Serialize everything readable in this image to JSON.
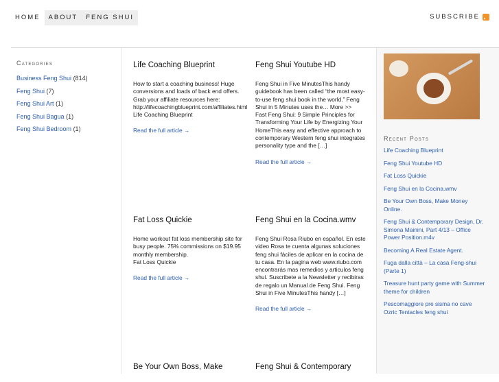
{
  "nav": {
    "items": [
      "HOME",
      "ABOUT",
      "FENG SHUI"
    ],
    "subscribe": "SUBSCRIBE"
  },
  "sidebar": {
    "title": "Categories",
    "categories": [
      {
        "name": "Business Feng Shui",
        "count": "(814)"
      },
      {
        "name": "Feng Shui",
        "count": "(7)"
      },
      {
        "name": "Feng Shui Art",
        "count": "(1)"
      },
      {
        "name": "Feng Shui Bagua",
        "count": "(1)"
      },
      {
        "name": "Feng Shui Bedroom",
        "count": "(1)"
      }
    ]
  },
  "posts": [
    {
      "title": "Life Coaching Blueprint",
      "excerpt": "How to start a coaching business! Huge conversions and loads of back end offers. Grab your affiliate resources here: http://lifecoachingblueprint.com/affiliates.html\nLife Coaching Blueprint",
      "more": "Read the full article →"
    },
    {
      "title": "Feng Shui Youtube HD",
      "excerpt": "Feng Shui in Five MinutesThis handy guidebook has been called “the most easy-to-use feng shui book in the world.” Feng Shui in 5 Minutes uses the… More >>\nFast Feng Shui: 9 Simple Principles for Transforming Your Life by Energizing Your HomeThis easy and effective approach to contemporary Western feng shui integrates personality type and the […]",
      "more": "Read the full article →"
    },
    {
      "title": "Fat Loss Quickie",
      "excerpt": "Home workout fat loss membership site for busy people. 75% commissions on $19.95 monthly membership.\nFat Loss Quickie",
      "more": "Read the full article →"
    },
    {
      "title": "Feng Shui en la Cocina.wmv",
      "excerpt": "Feng Shui Rosa Riubo en español. En este video Rosa te cuenta algunas soluciones feng shui fáciles de aplicar en la cocina de tu casa. En la pagina web www.riubo.com encontrarás mas remedios y articulos feng shui. Suscribete a la Newsletter y recibiras de regalo un Manual de Feng Shui. Feng Shui in Five MinutesThis handy […]",
      "more": "Read the full article →"
    },
    {
      "title": "Be Your Own Boss, Make",
      "excerpt": "",
      "more": ""
    },
    {
      "title": "Feng Shui & Contemporary",
      "excerpt": "",
      "more": ""
    }
  ],
  "recent": {
    "title": "Recent Posts",
    "items": [
      "Life Coaching Blueprint",
      "Feng Shui Youtube HD",
      "Fat Loss Quickie",
      "Feng Shui en la Cocina.wmv",
      "Be Your Own Boss, Make Money Online.",
      "Feng Shui & Contemporary Design, Dr. Simona Mainini, Part 4/13 – Office Power Position.m4v",
      "Becoming A Real Estate Agent.",
      "Fuga dalla città – La casa Feng-shui (Parte 1)",
      "Treasure hunt party game with Summer theme for children",
      "Pescomaggiore pre sisma no cave Ozric Tentacles feng shui"
    ]
  },
  "icons": {
    "rss": "rss-feed-icon",
    "photo": "food-plate-photo"
  },
  "colors": {
    "link": "#2a5db0",
    "rss": "#f0932b",
    "sidebar_bg": "#f7f7f7"
  }
}
